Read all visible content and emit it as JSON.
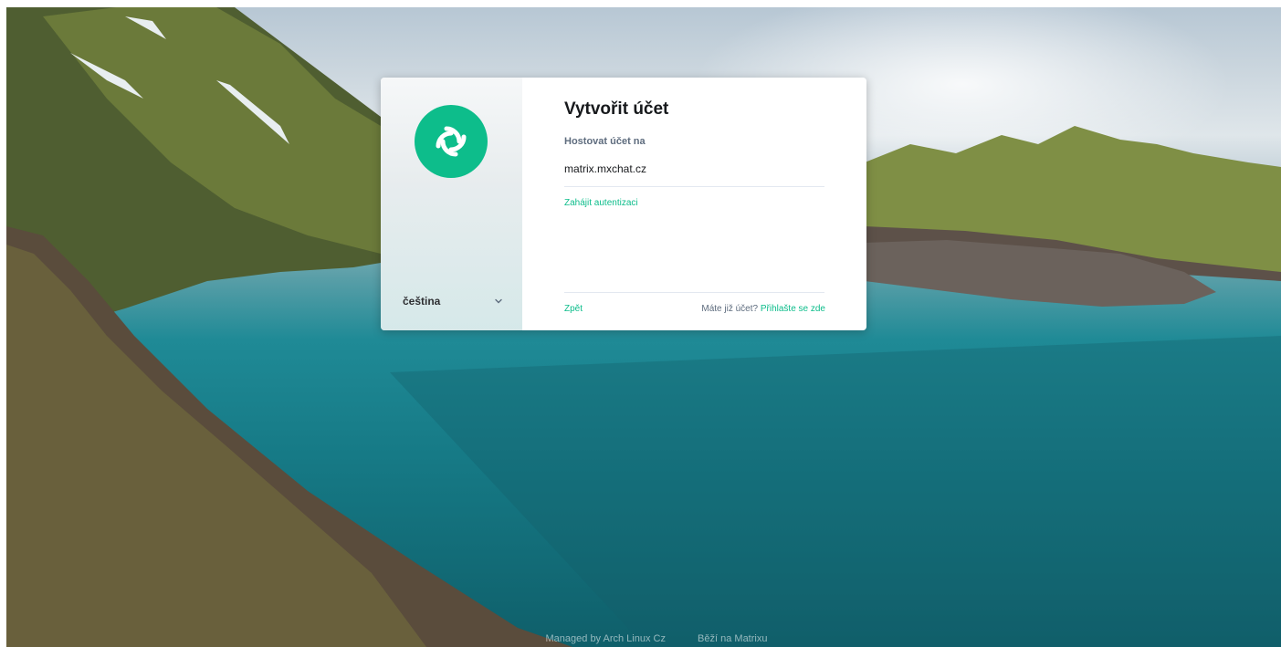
{
  "card": {
    "title": "Vytvořit účet",
    "host_label": "Hostovat účet na",
    "host_value": "matrix.mxchat.cz",
    "auth_link": "Zahájit autentizaci",
    "back_link": "Zpět",
    "login_prompt": "Máte již účet?",
    "login_link": "Přihlašte se zde"
  },
  "sidebar": {
    "language": "čeština",
    "logo_icon": "element-logo-icon",
    "chevron_icon": "chevron-down-icon"
  },
  "footer": {
    "managed_by": "Managed by Arch Linux Cz",
    "powered_by": "Běží na Matrixu"
  },
  "colors": {
    "accent": "#0dbd8b",
    "title": "#17191c",
    "muted": "#5e6c7e"
  }
}
